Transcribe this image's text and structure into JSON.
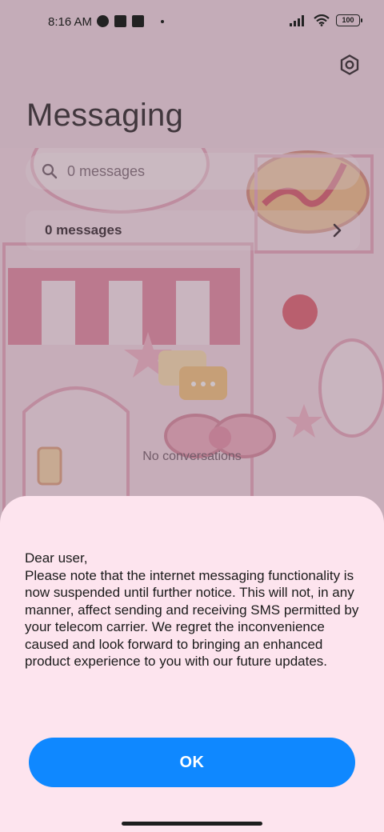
{
  "status_bar": {
    "time": "8:16 AM",
    "battery": "100",
    "icons": [
      "notification-icon",
      "app-icon",
      "upload-icon",
      "dot-icon",
      "signal-icon",
      "wifi-icon",
      "battery-icon"
    ]
  },
  "header": {
    "title": "Messaging",
    "settings_icon": "gear-icon"
  },
  "search": {
    "placeholder": "0 messages",
    "icon": "search-icon"
  },
  "message_row": {
    "label": "0 messages",
    "icon": "chevron-right-icon"
  },
  "empty_state": {
    "text": "No conversations"
  },
  "dialog": {
    "message": "Dear user,\nPlease note that the internet messaging functionality is now suspended until further notice. This will not, in any manner, affect sending and receiving SMS permitted by your telecom carrier. We regret the inconvenience caused and look forward to bringing an enhanced product experience to you with our future updates.",
    "ok_label": "OK"
  },
  "colors": {
    "accent": "#0f88ff",
    "sheet_background": "#fde4ee"
  }
}
